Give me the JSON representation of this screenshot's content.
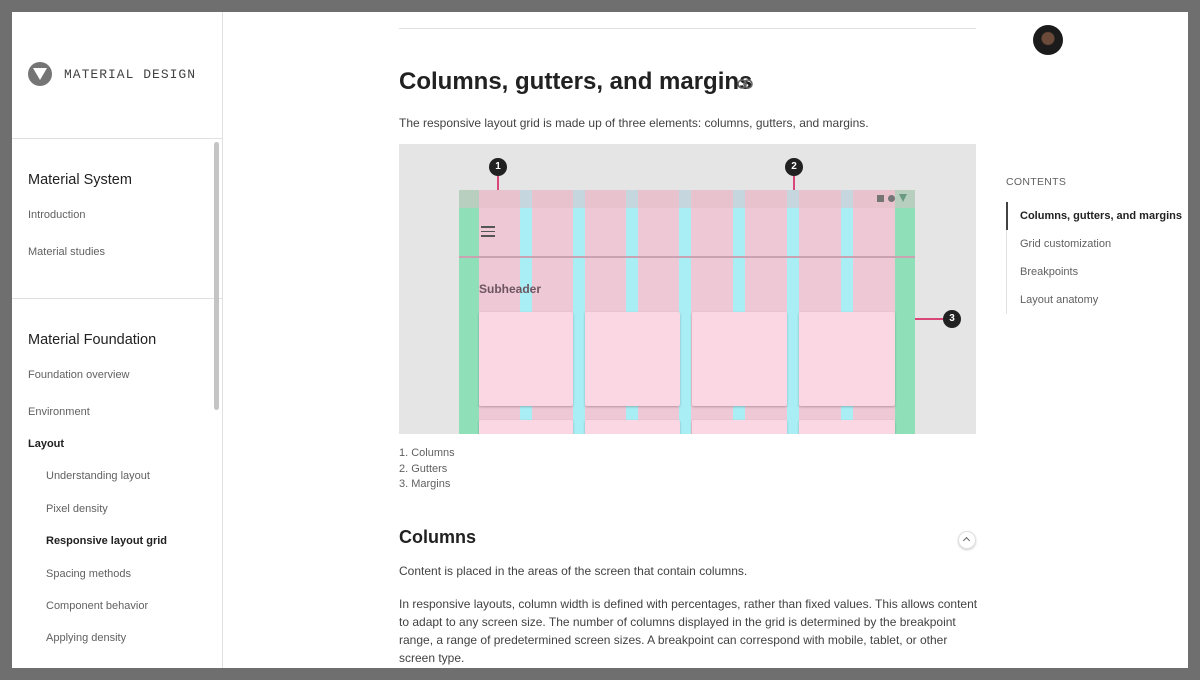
{
  "brand": {
    "name": "MATERIAL DESIGN"
  },
  "sidebar": {
    "sections": [
      {
        "heading": "Material System",
        "items": [
          "Introduction",
          "Material studies"
        ]
      },
      {
        "heading": "Material Foundation",
        "items": [
          "Foundation overview",
          "Environment",
          "Layout"
        ]
      }
    ],
    "layout_items": [
      "Understanding layout",
      "Pixel density",
      "Responsive layout grid",
      "Spacing methods",
      "Component behavior",
      "Applying density"
    ],
    "active_item": "Responsive layout grid"
  },
  "main": {
    "title": "Columns, gutters, and margins",
    "intro": "The responsive layout grid is made up of three elements: columns, gutters, and margins.",
    "figure": {
      "subheader": "Subheader",
      "callouts": [
        "1",
        "2",
        "3"
      ]
    },
    "legend": [
      "1. Columns",
      "2. Gutters",
      "3. Margins"
    ],
    "section": {
      "title": "Columns",
      "p1": "Content is placed in the areas of the screen that contain columns.",
      "p2": "In responsive layouts, column width is defined with percentages, rather than fixed values. This allows content to adapt to any screen size. The number of columns displayed in the grid is determined by the breakpoint range, a range of predetermined screen sizes. A breakpoint can correspond with mobile, tablet, or other screen type."
    }
  },
  "toc": {
    "title": "CONTENTS",
    "items": [
      "Columns, gutters, and margins",
      "Grid customization",
      "Breakpoints",
      "Layout anatomy"
    ],
    "active": "Columns, gutters, and margins"
  },
  "icons": {
    "brand": "material-logo-icon",
    "link": "link-icon",
    "menu": "hamburger-menu-icon",
    "collapse": "chevron-up-icon",
    "avatar": "user-avatar"
  },
  "colors": {
    "columns": "#f2c6d6",
    "gutters": "#a9eef4",
    "margins": "#8fe0b9",
    "callout": "#212121"
  }
}
